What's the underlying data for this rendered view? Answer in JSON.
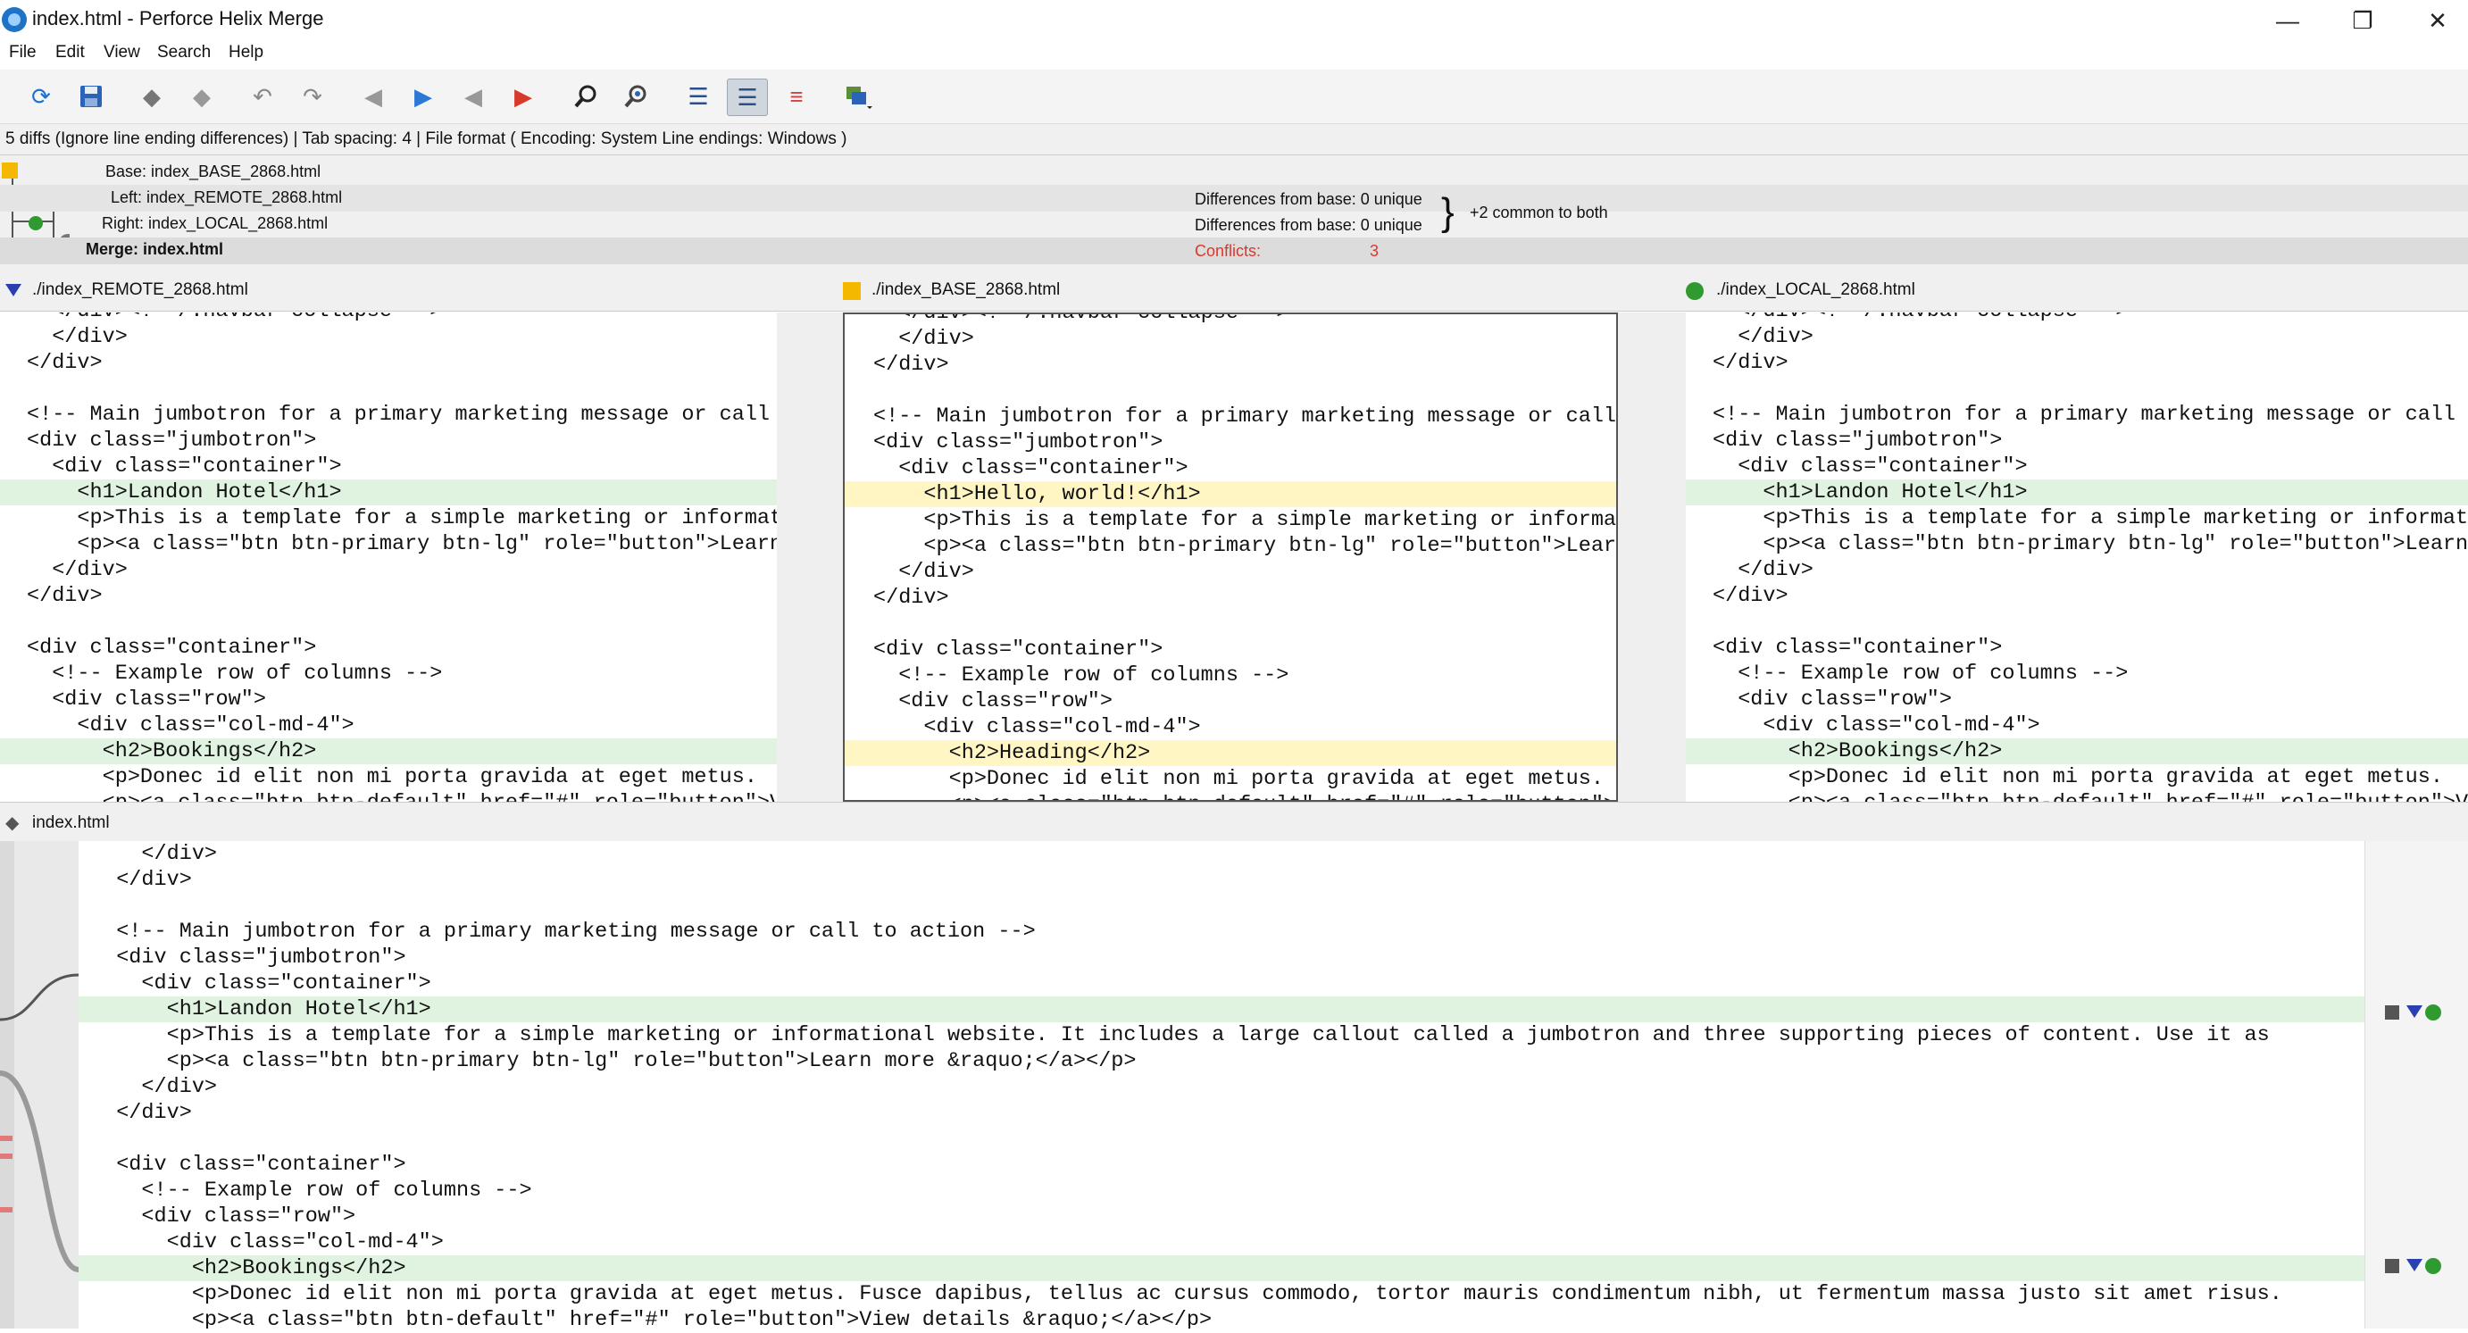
{
  "window": {
    "title": "index.html - Perforce Helix Merge",
    "min_glyph": "—",
    "max_glyph": "❐",
    "close_glyph": "✕"
  },
  "menu": [
    "File",
    "Edit",
    "View",
    "Search",
    "Help"
  ],
  "toolbar_icons": [
    "refresh-icon",
    "save-icon",
    "accept-icon",
    "reject-icon",
    "undo-icon",
    "redo-icon",
    "prev-diff-icon",
    "next-diff-icon",
    "prev-conflict-icon",
    "next-conflict-icon",
    "find-icon",
    "find-next-icon",
    "line-numbers-icon",
    "layout-icon",
    "whitespace-icon",
    "window-icon"
  ],
  "status": "5 diffs (Ignore line ending differences)  |  Tab spacing: 4  |  File format ( Encoding: System  Line endings: Windows )",
  "files": {
    "base": "Base: index_BASE_2868.html",
    "left": "Left: index_REMOTE_2868.html",
    "right": "Right: index_LOCAL_2868.html",
    "merge": "Merge: index.html",
    "left_diff": "Differences from base: 0 unique",
    "right_diff": "Differences from base: 0 unique",
    "common": "+2 common to both",
    "conflicts_label": "Conflicts:",
    "conflicts_value": "3"
  },
  "panes": {
    "left_title": "./index_REMOTE_2868.html",
    "base_title": "./index_BASE_2868.html",
    "right_title": "./index_LOCAL_2868.html",
    "merge_title": "index.html"
  },
  "left_lines": [
    {
      "text": "  </div><!--/.navbar-collapse -->",
      "hl": ""
    },
    {
      "text": "  </div>",
      "hl": ""
    },
    {
      "text": "</div>",
      "hl": ""
    },
    {
      "text": "",
      "hl": ""
    },
    {
      "text": "<!-- Main jumbotron for a primary marketing message or call to action -->",
      "hl": ""
    },
    {
      "text": "<div class=\"jumbotron\">",
      "hl": ""
    },
    {
      "text": "  <div class=\"container\">",
      "hl": ""
    },
    {
      "text": "    <h1>Landon Hotel</h1>",
      "hl": "green"
    },
    {
      "text": "    <p>This is a template for a simple marketing or informational website.",
      "hl": ""
    },
    {
      "text": "    <p><a class=\"btn btn-primary btn-lg\" role=\"button\">Learn more &raquo;</a></p>",
      "hl": ""
    },
    {
      "text": "  </div>",
      "hl": ""
    },
    {
      "text": "</div>",
      "hl": ""
    },
    {
      "text": "",
      "hl": ""
    },
    {
      "text": "<div class=\"container\">",
      "hl": ""
    },
    {
      "text": "  <!-- Example row of columns -->",
      "hl": ""
    },
    {
      "text": "  <div class=\"row\">",
      "hl": ""
    },
    {
      "text": "    <div class=\"col-md-4\">",
      "hl": ""
    },
    {
      "text": "      <h2>Bookings</h2>",
      "hl": "green"
    },
    {
      "text": "      <p>Donec id elit non mi porta gravida at eget metus.",
      "hl": ""
    },
    {
      "text": "      <p><a class=\"btn btn-default\" href=\"#\" role=\"button\">View details</a></p>",
      "hl": ""
    }
  ],
  "base_lines": [
    {
      "text": "  </div><!--/.navbar-collapse -->",
      "hl": ""
    },
    {
      "text": "  </div>",
      "hl": ""
    },
    {
      "text": "</div>",
      "hl": ""
    },
    {
      "text": "",
      "hl": ""
    },
    {
      "text": "<!-- Main jumbotron for a primary marketing message or call to action -->",
      "hl": ""
    },
    {
      "text": "<div class=\"jumbotron\">",
      "hl": ""
    },
    {
      "text": "  <div class=\"container\">",
      "hl": ""
    },
    {
      "text": "    <h1>Hello, world!</h1>",
      "hl": "yellow"
    },
    {
      "text": "    <p>This is a template for a simple marketing or informational website.",
      "hl": ""
    },
    {
      "text": "    <p><a class=\"btn btn-primary btn-lg\" role=\"button\">Learn more &raquo;</a></p>",
      "hl": ""
    },
    {
      "text": "  </div>",
      "hl": ""
    },
    {
      "text": "</div>",
      "hl": ""
    },
    {
      "text": "",
      "hl": ""
    },
    {
      "text": "<div class=\"container\">",
      "hl": ""
    },
    {
      "text": "  <!-- Example row of columns -->",
      "hl": ""
    },
    {
      "text": "  <div class=\"row\">",
      "hl": ""
    },
    {
      "text": "    <div class=\"col-md-4\">",
      "hl": ""
    },
    {
      "text": "      <h2>Heading</h2>",
      "hl": "yellow"
    },
    {
      "text": "      <p>Donec id elit non mi porta gravida at eget metus.",
      "hl": ""
    },
    {
      "text": "      <p><a class=\"btn btn-default\" href=\"#\" role=\"button\">View details</a></p>",
      "hl": ""
    }
  ],
  "right_lines": [
    {
      "text": "  </div><!--/.navbar-collapse -->",
      "hl": ""
    },
    {
      "text": "  </div>",
      "hl": ""
    },
    {
      "text": "</div>",
      "hl": ""
    },
    {
      "text": "",
      "hl": ""
    },
    {
      "text": "<!-- Main jumbotron for a primary marketing message or call to action -->",
      "hl": ""
    },
    {
      "text": "<div class=\"jumbotron\">",
      "hl": ""
    },
    {
      "text": "  <div class=\"container\">",
      "hl": ""
    },
    {
      "text": "    <h1>Landon Hotel</h1>",
      "hl": "green"
    },
    {
      "text": "    <p>This is a template for a simple marketing or informational website.",
      "hl": ""
    },
    {
      "text": "    <p><a class=\"btn btn-primary btn-lg\" role=\"button\">Learn more &raquo;</a></p>",
      "hl": ""
    },
    {
      "text": "  </div>",
      "hl": ""
    },
    {
      "text": "</div>",
      "hl": ""
    },
    {
      "text": "",
      "hl": ""
    },
    {
      "text": "<div class=\"container\">",
      "hl": ""
    },
    {
      "text": "  <!-- Example row of columns -->",
      "hl": ""
    },
    {
      "text": "  <div class=\"row\">",
      "hl": ""
    },
    {
      "text": "    <div class=\"col-md-4\">",
      "hl": ""
    },
    {
      "text": "      <h2>Bookings</h2>",
      "hl": "green"
    },
    {
      "text": "      <p>Donec id elit non mi porta gravida at eget metus.",
      "hl": ""
    },
    {
      "text": "      <p><a class=\"btn btn-default\" href=\"#\" role=\"button\">View details</a></p>",
      "hl": ""
    }
  ],
  "merge_lines": [
    {
      "text": "    </div>",
      "hl": ""
    },
    {
      "text": "  </div>",
      "hl": ""
    },
    {
      "text": "",
      "hl": ""
    },
    {
      "text": "  <!-- Main jumbotron for a primary marketing message or call to action -->",
      "hl": ""
    },
    {
      "text": "  <div class=\"jumbotron\">",
      "hl": ""
    },
    {
      "text": "    <div class=\"container\">",
      "hl": ""
    },
    {
      "text": "      <h1>Landon Hotel</h1>",
      "hl": "green"
    },
    {
      "text": "      <p>This is a template for a simple marketing or informational website. It includes a large callout called a jumbotron and three supporting pieces of content. Use it as",
      "hl": ""
    },
    {
      "text": "      <p><a class=\"btn btn-primary btn-lg\" role=\"button\">Learn more &raquo;</a></p>",
      "hl": ""
    },
    {
      "text": "    </div>",
      "hl": ""
    },
    {
      "text": "  </div>",
      "hl": ""
    },
    {
      "text": "",
      "hl": ""
    },
    {
      "text": "  <div class=\"container\">",
      "hl": ""
    },
    {
      "text": "    <!-- Example row of columns -->",
      "hl": ""
    },
    {
      "text": "    <div class=\"row\">",
      "hl": ""
    },
    {
      "text": "      <div class=\"col-md-4\">",
      "hl": ""
    },
    {
      "text": "        <h2>Bookings</h2>",
      "hl": "green"
    },
    {
      "text": "        <p>Donec id elit non mi porta gravida at eget metus. Fusce dapibus, tellus ac cursus commodo, tortor mauris condimentum nibh, ut fermentum massa justo sit amet risus.",
      "hl": ""
    },
    {
      "text": "        <p><a class=\"btn btn-default\" href=\"#\" role=\"button\">View details &raquo;</a></p>",
      "hl": ""
    }
  ],
  "colors": {
    "conflict_red": "#e0352b",
    "base_marker": "#f5b800",
    "left_marker": "#2a3fb0",
    "right_marker": "#2f9a2f",
    "diff_green": "#e0f2e0",
    "diff_yellow": "#fff6c4"
  }
}
